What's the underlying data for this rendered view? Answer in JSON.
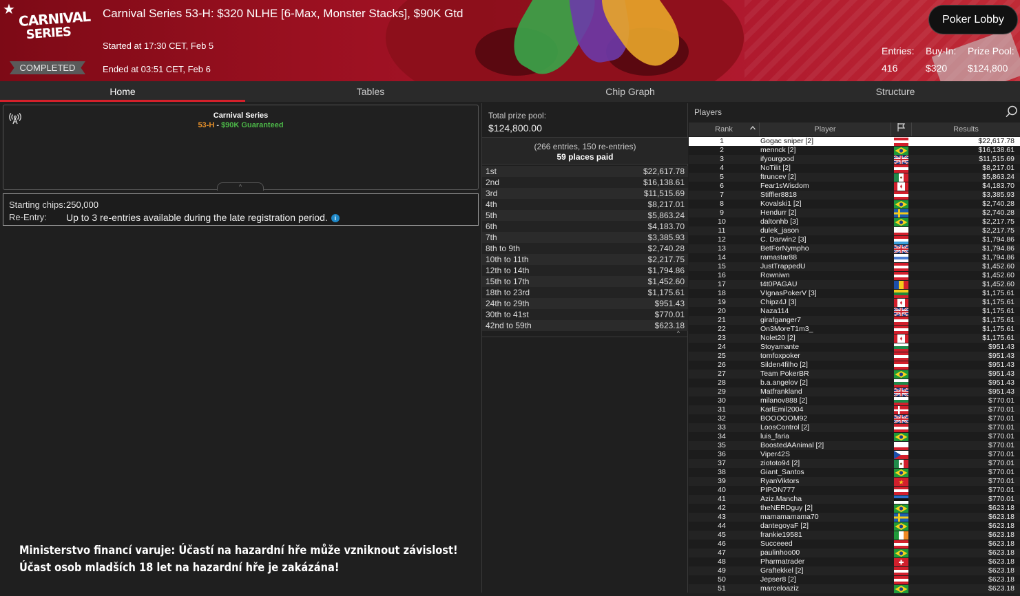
{
  "header": {
    "logo_line1": "CARNIVAL",
    "logo_line2": "SERIES",
    "status_badge": "COMPLETED",
    "title": "Carnival Series 53-H: $320 NLHE [6-Max, Monster Stacks], $90K Gtd",
    "started": "Started at 17:30 CET, Feb 5",
    "ended": "Ended at 03:51 CET, Feb 6",
    "lobby_button": "Poker Lobby",
    "stats": {
      "entries_label": "Entries:",
      "entries_value": "416",
      "buyin_label": "Buy-In:",
      "buyin_value": "$320",
      "prize_label": "Prize Pool:",
      "prize_value": "$124,800"
    },
    "icons": {
      "favorite": "star-icon"
    }
  },
  "tabs": [
    "Home",
    "Tables",
    "Chip Graph",
    "Structure"
  ],
  "active_tab": "Home",
  "info_card": {
    "series_name": "Carnival Series",
    "event_code": "53-H",
    "separator": " - ",
    "guarantee": "$90K Guaranteed",
    "icon": "broadcast-icon"
  },
  "chips_card": {
    "starting_label": "Starting chips:",
    "starting_value": "250,000",
    "reentry_label": "Re-Entry:",
    "reentry_value": "Up to 3 re-entries available during the late registration period."
  },
  "warning": {
    "line1": "Ministerstvo financí varuje: Účastí na hazardní hře může vzniknout závislost!",
    "line2": "Účast osob mladších 18 let na hazardní hře je zakázána!"
  },
  "prize_panel": {
    "pool_label": "Total prize pool:",
    "pool_value": "$124,800.00",
    "entries_breakdown": "(266 entries, 150 re-entries)",
    "places_paid": "59 places paid",
    "payouts": [
      [
        "1st",
        "$22,617.78"
      ],
      [
        "2nd",
        "$16,138.61"
      ],
      [
        "3rd",
        "$11,515.69"
      ],
      [
        "4th",
        "$8,217.01"
      ],
      [
        "5th",
        "$5,863.24"
      ],
      [
        "6th",
        "$4,183.70"
      ],
      [
        "7th",
        "$3,385.93"
      ],
      [
        "8th to 9th",
        "$2,740.28"
      ],
      [
        "10th to 11th",
        "$2,217.75"
      ],
      [
        "12th to 14th",
        "$1,794.86"
      ],
      [
        "15th to 17th",
        "$1,452.60"
      ],
      [
        "18th to 23rd",
        "$1,175.61"
      ],
      [
        "24th to 29th",
        "$951.43"
      ],
      [
        "30th to 41st",
        "$770.01"
      ],
      [
        "42nd to 59th",
        "$623.18"
      ]
    ]
  },
  "players_panel": {
    "title": "Players",
    "columns": {
      "rank": "Rank",
      "player": "Player",
      "results": "Results"
    },
    "rows": [
      [
        "1",
        "Gogac sniper [2]",
        "at",
        "$22,617.78"
      ],
      [
        "2",
        "mennck [2]",
        "br",
        "$16,138.61"
      ],
      [
        "3",
        "ifyourgood",
        "gb",
        "$11,515.69"
      ],
      [
        "4",
        "NoTilit [2]",
        "at",
        "$8,217.01"
      ],
      [
        "5",
        "ftruncev [2]",
        "mx",
        "$5,863.24"
      ],
      [
        "6",
        "Fear1sWisdom",
        "ca",
        "$4,183.70"
      ],
      [
        "7",
        "Stiffler8818",
        "at",
        "$3,385.93"
      ],
      [
        "8",
        "Kovalski1 [2]",
        "br",
        "$2,740.28"
      ],
      [
        "9",
        "Hendurr [2]",
        "se",
        "$2,740.28"
      ],
      [
        "10",
        "daltonhb [3]",
        "br",
        "$2,217.75"
      ],
      [
        "11",
        "dulek_jason",
        "pl",
        "$2,217.75"
      ],
      [
        "12",
        "C. Darwin2 [3]",
        "lu",
        "$1,794.86"
      ],
      [
        "13",
        "BetForNympho",
        "gb",
        "$1,794.86"
      ],
      [
        "14",
        "ramastar88",
        "uy",
        "$1,794.86"
      ],
      [
        "15",
        "JustTrappedU",
        "at",
        "$1,452.60"
      ],
      [
        "16",
        "Rowniwn",
        "at",
        "$1,452.60"
      ],
      [
        "17",
        "t4t0PAGAU",
        "md",
        "$1,452.60"
      ],
      [
        "18",
        "VIgnasPokerV [3]",
        "lt",
        "$1,175.61"
      ],
      [
        "19",
        "Chipz4J [3]",
        "ca",
        "$1,175.61"
      ],
      [
        "20",
        "Naza114",
        "gb",
        "$1,175.61"
      ],
      [
        "21",
        "girafganger7",
        "at",
        "$1,175.61"
      ],
      [
        "22",
        "On3MoreT1m3_",
        "at",
        "$1,175.61"
      ],
      [
        "23",
        "Nolet20 [2]",
        "ca",
        "$1,175.61"
      ],
      [
        "24",
        "Stoyamante",
        "bg",
        "$951.43"
      ],
      [
        "25",
        "tomfoxpoker",
        "at",
        "$951.43"
      ],
      [
        "26",
        "Silden4filho [2]",
        "at",
        "$951.43"
      ],
      [
        "27",
        "Team PokerBR",
        "br",
        "$951.43"
      ],
      [
        "28",
        "b.a.angelov [2]",
        "bg",
        "$951.43"
      ],
      [
        "29",
        "Matfrankland",
        "gb",
        "$951.43"
      ],
      [
        "30",
        "milanov888 [2]",
        "bg",
        "$770.01"
      ],
      [
        "31",
        "KarlEmil2004",
        "dk",
        "$770.01"
      ],
      [
        "32",
        "BOOOOOM92",
        "gb",
        "$770.01"
      ],
      [
        "33",
        "LoosControl [2]",
        "at",
        "$770.01"
      ],
      [
        "34",
        "luis_faria",
        "br",
        "$770.01"
      ],
      [
        "35",
        "BoostedAAnimal [2]",
        "pl",
        "$770.01"
      ],
      [
        "36",
        "Viper42S",
        "cz",
        "$770.01"
      ],
      [
        "37",
        "ziototo94 [2]",
        "mx",
        "$770.01"
      ],
      [
        "38",
        "Giant_Santos",
        "br",
        "$770.01"
      ],
      [
        "39",
        "RyanViktors",
        "vn",
        "$770.01"
      ],
      [
        "40",
        "PIPON777",
        "at",
        "$770.01"
      ],
      [
        "41",
        "Aziz.Mancha",
        "ee",
        "$770.01"
      ],
      [
        "42",
        "theNERDguy [2]",
        "br",
        "$623.18"
      ],
      [
        "43",
        "mamamamama70",
        "se",
        "$623.18"
      ],
      [
        "44",
        "dantegoyaF [2]",
        "br",
        "$623.18"
      ],
      [
        "45",
        "frankie19581",
        "ie",
        "$623.18"
      ],
      [
        "46",
        "Succeeed",
        "at",
        "$623.18"
      ],
      [
        "47",
        "paulinhoo00",
        "br",
        "$623.18"
      ],
      [
        "48",
        "Pharmatrader",
        "ch",
        "$623.18"
      ],
      [
        "49",
        "Graftekkel [2]",
        "at",
        "$623.18"
      ],
      [
        "50",
        "Jepser8 [2]",
        "at",
        "$623.18"
      ],
      [
        "51",
        "marceloaziz",
        "br",
        "$623.18"
      ]
    ],
    "flag_colors": {
      "at": [
        "#d21f2c",
        "#ffffff",
        "#d21f2c"
      ],
      "br": [
        "#1f9a3a",
        "#f5d31c",
        "#1f9a3a"
      ],
      "gb": [
        "#1f3a8c",
        "#ffffff",
        "#c8202c"
      ],
      "mx": [
        "#ffffff",
        "#ffffff",
        "#ffffff"
      ],
      "ca": [
        "#d21f2c",
        "#ffffff",
        "#d21f2c"
      ],
      "se": [
        "#1d5fae",
        "#f4cb1c",
        "#1d5fae"
      ],
      "pl": [
        "#ffffff",
        "#ffffff",
        "#d21f2c"
      ],
      "lu": [
        "#d21f2c",
        "#ffffff",
        "#3aa0dc"
      ],
      "uy": [
        "#ffffff",
        "#4a7bd0",
        "#ffffff"
      ],
      "md": [
        "#1d4faa",
        "#f4cb1c",
        "#d21f2c"
      ],
      "lt": [
        "#f4cb1c",
        "#1f8a3a",
        "#d21f2c"
      ],
      "bg": [
        "#ffffff",
        "#1f8a4a",
        "#d21f2c"
      ],
      "dk": [
        "#d21f2c",
        "#ffffff",
        "#d21f2c"
      ],
      "cz": [
        "#ffffff",
        "#d21f2c",
        "#1d4faa"
      ],
      "vn": [
        "#d21f2c",
        "#d21f2c",
        "#d21f2c"
      ],
      "ee": [
        "#2a6ec8",
        "#111111",
        "#ffffff"
      ],
      "ie": [
        "#1f9a3a",
        "#ffffff",
        "#ef8a24"
      ],
      "ch": [
        "#d21f2c",
        "#d21f2c",
        "#d21f2c"
      ]
    }
  }
}
